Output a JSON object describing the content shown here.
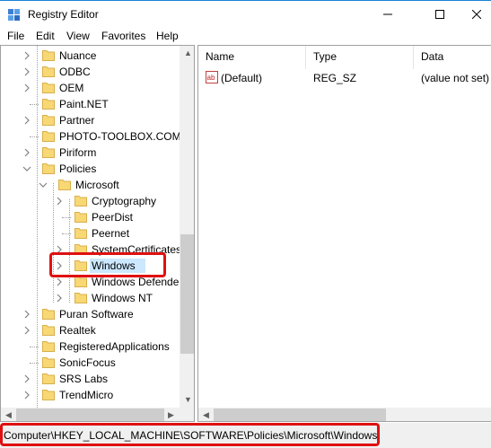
{
  "window": {
    "title": "Registry Editor"
  },
  "menu": [
    "File",
    "Edit",
    "View",
    "Favorites",
    "Help"
  ],
  "tree": [
    {
      "label": "Nuance"
    },
    {
      "label": "ODBC"
    },
    {
      "label": "OEM"
    },
    {
      "label": "Paint.NET"
    },
    {
      "label": "Partner"
    },
    {
      "label": "PHOTO-TOOLBOX.COM"
    },
    {
      "label": "Piriform"
    },
    {
      "label": "Policies"
    },
    {
      "label": "Microsoft"
    },
    {
      "label": "Cryptography"
    },
    {
      "label": "PeerDist"
    },
    {
      "label": "Peernet"
    },
    {
      "label": "SystemCertificates"
    },
    {
      "label": "Windows"
    },
    {
      "label": "Windows Defender"
    },
    {
      "label": "Windows NT"
    },
    {
      "label": "Puran Software"
    },
    {
      "label": "Realtek"
    },
    {
      "label": "RegisteredApplications"
    },
    {
      "label": "SonicFocus"
    },
    {
      "label": "SRS Labs"
    },
    {
      "label": "TrendMicro"
    }
  ],
  "columns": {
    "name": "Name",
    "type": "Type",
    "data": "Data"
  },
  "values": [
    {
      "name": "(Default)",
      "type": "REG_SZ",
      "data": "(value not set)"
    }
  ],
  "status": {
    "path": "Computer\\HKEY_LOCAL_MACHINE\\SOFTWARE\\Policies\\Microsoft\\Windows"
  },
  "colors": {
    "highlight": "#e01010",
    "selection": "#cce8ff",
    "folder": "#f8d775"
  }
}
